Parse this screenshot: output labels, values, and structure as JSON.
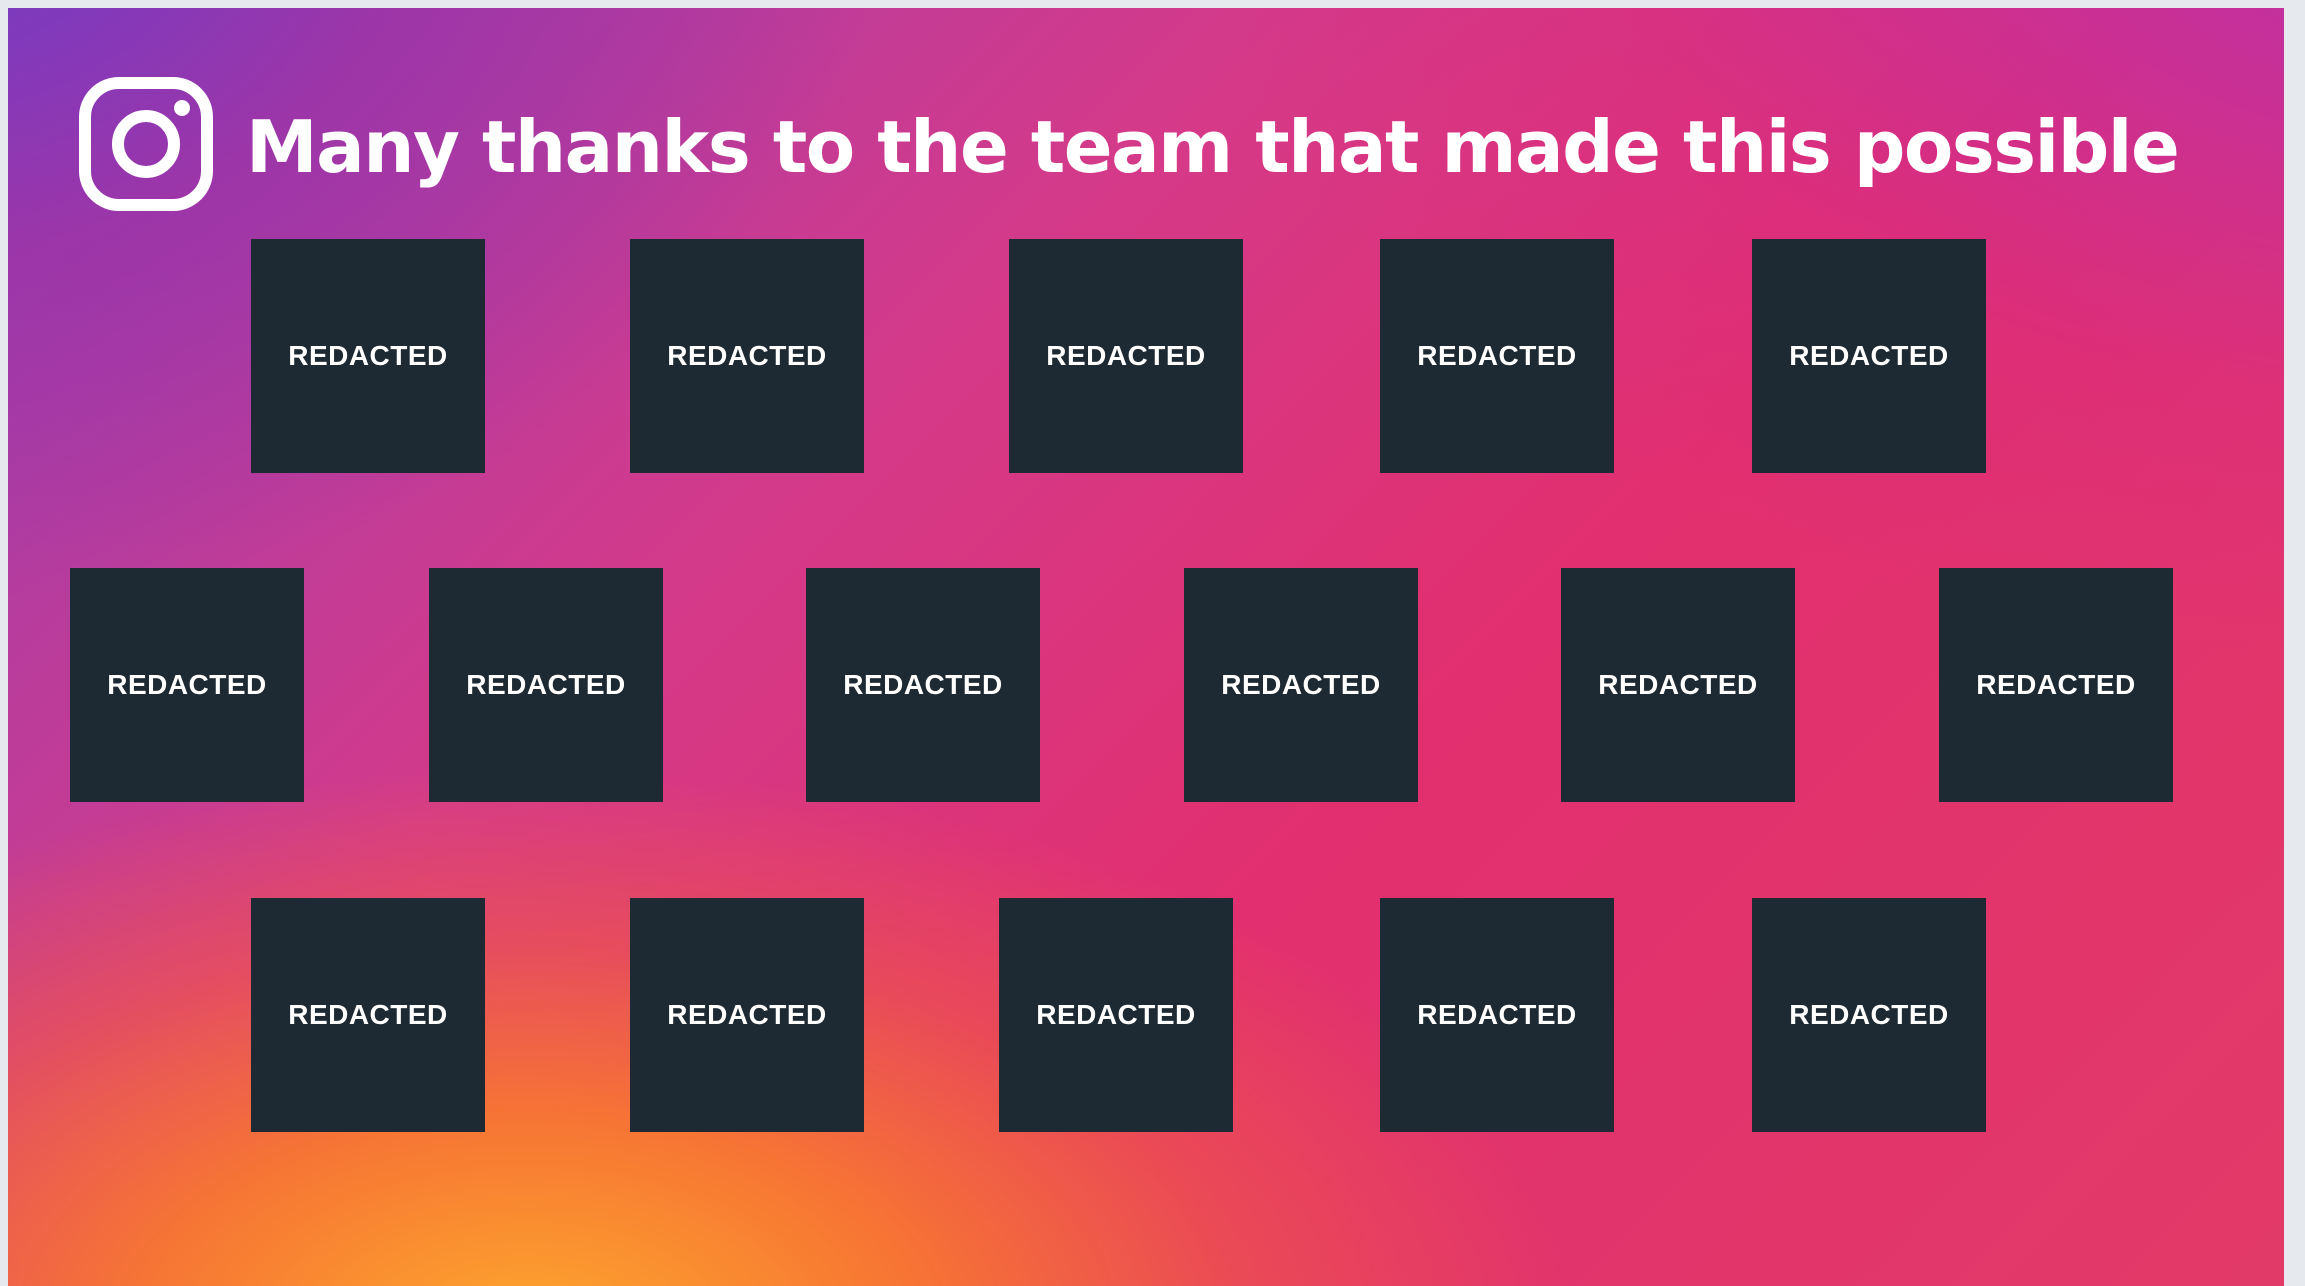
{
  "slide": {
    "title": "Many thanks to the team that made this possible",
    "logo_icon": "instagram-logo-icon"
  },
  "team": {
    "row1": [
      {
        "label": "REDACTED"
      },
      {
        "label": "REDACTED"
      },
      {
        "label": "REDACTED"
      },
      {
        "label": "REDACTED"
      },
      {
        "label": "REDACTED"
      }
    ],
    "row2": [
      {
        "label": "REDACTED"
      },
      {
        "label": "REDACTED"
      },
      {
        "label": "REDACTED"
      },
      {
        "label": "REDACTED"
      },
      {
        "label": "REDACTED"
      },
      {
        "label": "REDACTED"
      }
    ],
    "row3": [
      {
        "label": "REDACTED"
      },
      {
        "label": "REDACTED"
      },
      {
        "label": "REDACTED"
      },
      {
        "label": "REDACTED"
      },
      {
        "label": "REDACTED"
      }
    ]
  },
  "colors": {
    "card_background": "#1e2a33",
    "text": "#ffffff",
    "gradient": [
      "#6e3cc8",
      "#d43a8a",
      "#e22f6f",
      "#fda62d"
    ]
  }
}
